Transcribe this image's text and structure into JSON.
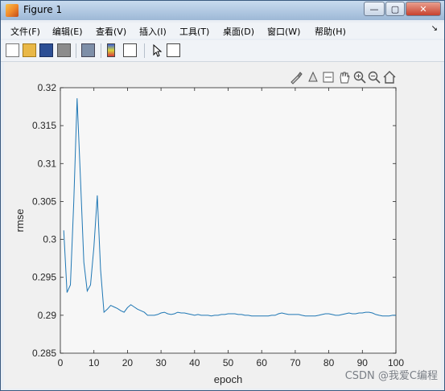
{
  "window": {
    "title": "Figure 1",
    "minimize": "—",
    "maximize": "▢",
    "close": "✕"
  },
  "menu": {
    "items": [
      "文件(F)",
      "编辑(E)",
      "查看(V)",
      "插入(I)",
      "工具(T)",
      "桌面(D)",
      "窗口(W)",
      "帮助(H)"
    ],
    "corner": "↘"
  },
  "toolbar": {
    "icons": [
      "new-figure-icon",
      "open-file-icon",
      "save-icon",
      "print-icon",
      "print-preview-icon",
      "colorbar-icon",
      "legend-icon",
      "pointer-icon",
      "property-editor-icon"
    ]
  },
  "axes_toolbar": {
    "icons": [
      "brush-icon",
      "data-tip-icon",
      "pan-icon",
      "zoom-in-icon",
      "zoom-out-icon",
      "home-icon"
    ]
  },
  "colors": {
    "line": "#1f77b4",
    "axes_bg": "#f7f7f7"
  },
  "chart_data": {
    "type": "line",
    "xlabel": "epoch",
    "ylabel": "rmse",
    "xlim": [
      0,
      100
    ],
    "ylim": [
      0.285,
      0.32
    ],
    "xticks": [
      0,
      10,
      20,
      30,
      40,
      50,
      60,
      70,
      80,
      90,
      100
    ],
    "yticks": [
      0.285,
      0.29,
      0.295,
      0.3,
      0.305,
      0.31,
      0.315,
      0.32
    ],
    "ytick_labels": [
      "0.285",
      "0.29",
      "0.295",
      "0.3",
      "0.305",
      "0.31",
      "0.315",
      "0.32"
    ],
    "grid": false,
    "x": [
      1,
      2,
      3,
      4,
      5,
      6,
      7,
      8,
      9,
      10,
      11,
      12,
      13,
      14,
      15,
      16,
      17,
      18,
      19,
      20,
      21,
      22,
      23,
      24,
      25,
      26,
      27,
      28,
      29,
      30,
      31,
      32,
      33,
      34,
      35,
      36,
      37,
      38,
      39,
      40,
      41,
      42,
      43,
      44,
      45,
      46,
      47,
      48,
      49,
      50,
      51,
      52,
      53,
      54,
      55,
      56,
      57,
      58,
      59,
      60,
      61,
      62,
      63,
      64,
      65,
      66,
      67,
      68,
      69,
      70,
      71,
      72,
      73,
      74,
      75,
      76,
      77,
      78,
      79,
      80,
      81,
      82,
      83,
      84,
      85,
      86,
      87,
      88,
      89,
      90,
      91,
      92,
      93,
      94,
      95,
      96,
      97,
      98,
      99,
      100
    ],
    "y": [
      0.3012,
      0.293,
      0.294,
      0.305,
      0.3186,
      0.308,
      0.297,
      0.2932,
      0.294,
      0.299,
      0.3058,
      0.296,
      0.2904,
      0.2908,
      0.2913,
      0.2911,
      0.2909,
      0.2906,
      0.2904,
      0.291,
      0.2914,
      0.2911,
      0.2908,
      0.2906,
      0.2904,
      0.29,
      0.29,
      0.29,
      0.2901,
      0.2903,
      0.2904,
      0.2902,
      0.2901,
      0.2902,
      0.2904,
      0.2903,
      0.2903,
      0.2902,
      0.2901,
      0.29,
      0.2901,
      0.29,
      0.29,
      0.29,
      0.2899,
      0.29,
      0.29,
      0.2901,
      0.2901,
      0.2902,
      0.2902,
      0.2902,
      0.2901,
      0.2901,
      0.29,
      0.29,
      0.2899,
      0.2899,
      0.2899,
      0.2899,
      0.2899,
      0.2899,
      0.29,
      0.29,
      0.2902,
      0.2903,
      0.2902,
      0.2901,
      0.2901,
      0.2901,
      0.2901,
      0.29,
      0.2899,
      0.2899,
      0.2899,
      0.2899,
      0.29,
      0.2901,
      0.2902,
      0.2902,
      0.2901,
      0.29,
      0.29,
      0.2901,
      0.2902,
      0.2903,
      0.2902,
      0.2902,
      0.2903,
      0.2903,
      0.2904,
      0.2904,
      0.2903,
      0.2901,
      0.29,
      0.2899,
      0.2899,
      0.2899,
      0.29,
      0.29
    ]
  },
  "watermark": "CSDN @我爱C编程"
}
